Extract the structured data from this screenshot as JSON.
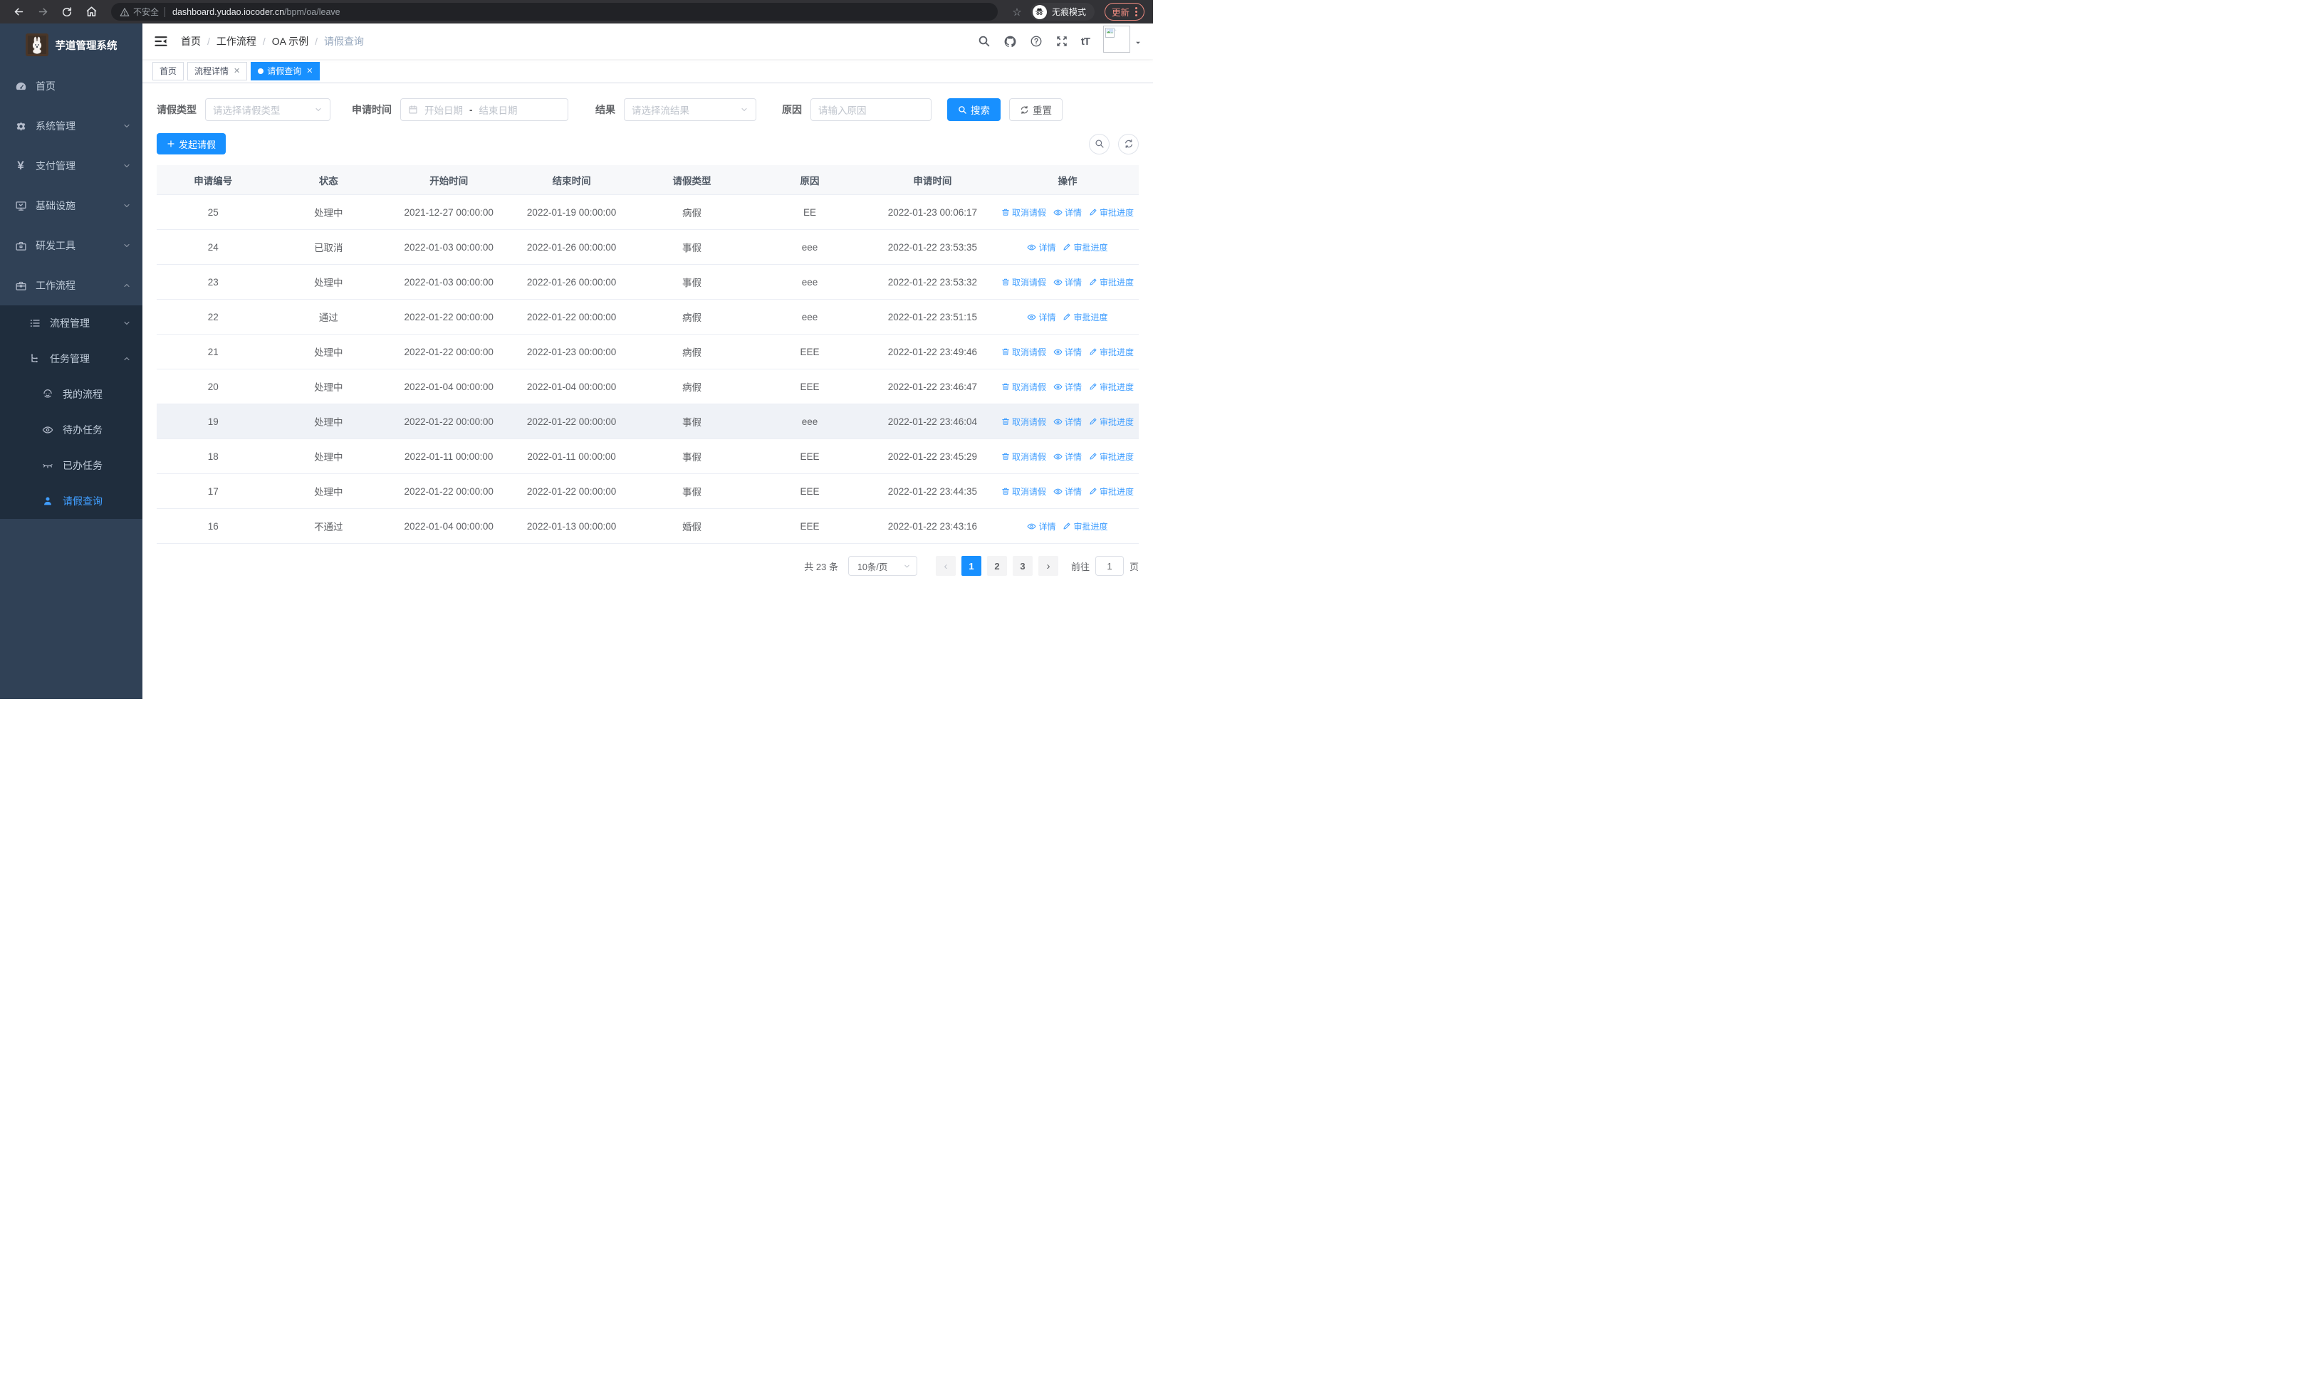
{
  "browser": {
    "security_label": "不安全",
    "url_host": "dashboard.yudao.iocoder.cn",
    "url_path": "/bpm/oa/leave",
    "incognito_label": "无痕模式",
    "update_label": "更新",
    "nav_icons": [
      "back-icon",
      "forward-icon",
      "reload-icon",
      "home-icon"
    ],
    "right_icons": [
      "bookmark-star-icon",
      "incognito-icon",
      "more-menu-icon"
    ]
  },
  "sidebar": {
    "title": "芋道管理系统",
    "items": [
      {
        "label": "首页",
        "icon": "dashboard-icon",
        "chevron": "none"
      },
      {
        "label": "系统管理",
        "icon": "gear-icon",
        "chevron": "down"
      },
      {
        "label": "支付管理",
        "icon": "yen-icon",
        "chevron": "down"
      },
      {
        "label": "基础设施",
        "icon": "monitor-icon",
        "chevron": "down"
      },
      {
        "label": "研发工具",
        "icon": "toolbox-icon",
        "chevron": "down"
      },
      {
        "label": "工作流程",
        "icon": "briefcase-icon",
        "chevron": "up"
      }
    ],
    "submenu": [
      {
        "label": "流程管理",
        "icon": "list-icon",
        "chevron": "down"
      },
      {
        "label": "任务管理",
        "icon": "flow-icon",
        "chevron": "up"
      }
    ],
    "task_items": [
      {
        "label": "我的流程",
        "icon": "robot-icon",
        "active": false
      },
      {
        "label": "待办任务",
        "icon": "eye-open-icon",
        "active": false
      },
      {
        "label": "已办任务",
        "icon": "eye-closed-icon",
        "active": false
      },
      {
        "label": "请假查询",
        "icon": "user-icon",
        "active": true
      }
    ]
  },
  "navbar": {
    "breadcrumb": [
      "首页",
      "工作流程",
      "OA 示例",
      "请假查询"
    ],
    "right_icons": [
      "search-icon",
      "github-icon",
      "help-icon",
      "fullscreen-icon",
      "font-size-icon",
      "avatar-image",
      "caret-down-icon"
    ]
  },
  "tabs": [
    {
      "label": "首页",
      "closable": false,
      "active": false
    },
    {
      "label": "流程详情",
      "closable": true,
      "active": false
    },
    {
      "label": "请假查询",
      "closable": true,
      "active": true
    }
  ],
  "filters": {
    "leave_type_label": "请假类型",
    "leave_type_placeholder": "请选择请假类型",
    "apply_time_label": "申请时间",
    "date_start_placeholder": "开始日期",
    "date_separator": "-",
    "date_end_placeholder": "结束日期",
    "result_label": "结果",
    "result_placeholder": "请选择流结果",
    "reason_label": "原因",
    "reason_placeholder": "请输入原因",
    "search_label": "搜索",
    "reset_label": "重置"
  },
  "toolbar": {
    "create_label": "发起请假",
    "icons": [
      "zoom-search-icon",
      "refresh-icon"
    ]
  },
  "table": {
    "columns": [
      "申请编号",
      "状态",
      "开始时间",
      "结束时间",
      "请假类型",
      "原因",
      "申请时间",
      "操作"
    ],
    "actions": {
      "cancel": "取消请假",
      "detail": "详情",
      "progress": "审批进度"
    },
    "rows": [
      {
        "id": "25",
        "status": "处理中",
        "start": "2021-12-27 00:00:00",
        "end": "2022-01-19 00:00:00",
        "type": "病假",
        "reason": "EE",
        "apply_time": "2022-01-23 00:06:17",
        "actions": [
          "cancel",
          "detail",
          "progress"
        ],
        "highlight": false
      },
      {
        "id": "24",
        "status": "已取消",
        "start": "2022-01-03 00:00:00",
        "end": "2022-01-26 00:00:00",
        "type": "事假",
        "reason": "eee",
        "apply_time": "2022-01-22 23:53:35",
        "actions": [
          "detail",
          "progress"
        ],
        "highlight": false
      },
      {
        "id": "23",
        "status": "处理中",
        "start": "2022-01-03 00:00:00",
        "end": "2022-01-26 00:00:00",
        "type": "事假",
        "reason": "eee",
        "apply_time": "2022-01-22 23:53:32",
        "actions": [
          "cancel",
          "detail",
          "progress"
        ],
        "highlight": false
      },
      {
        "id": "22",
        "status": "通过",
        "start": "2022-01-22 00:00:00",
        "end": "2022-01-22 00:00:00",
        "type": "病假",
        "reason": "eee",
        "apply_time": "2022-01-22 23:51:15",
        "actions": [
          "detail",
          "progress"
        ],
        "highlight": false
      },
      {
        "id": "21",
        "status": "处理中",
        "start": "2022-01-22 00:00:00",
        "end": "2022-01-23 00:00:00",
        "type": "病假",
        "reason": "EEE",
        "apply_time": "2022-01-22 23:49:46",
        "actions": [
          "cancel",
          "detail",
          "progress"
        ],
        "highlight": false
      },
      {
        "id": "20",
        "status": "处理中",
        "start": "2022-01-04 00:00:00",
        "end": "2022-01-04 00:00:00",
        "type": "病假",
        "reason": "EEE",
        "apply_time": "2022-01-22 23:46:47",
        "actions": [
          "cancel",
          "detail",
          "progress"
        ],
        "highlight": false
      },
      {
        "id": "19",
        "status": "处理中",
        "start": "2022-01-22 00:00:00",
        "end": "2022-01-22 00:00:00",
        "type": "事假",
        "reason": "eee",
        "apply_time": "2022-01-22 23:46:04",
        "actions": [
          "cancel",
          "detail",
          "progress"
        ],
        "highlight": true
      },
      {
        "id": "18",
        "status": "处理中",
        "start": "2022-01-11 00:00:00",
        "end": "2022-01-11 00:00:00",
        "type": "事假",
        "reason": "EEE",
        "apply_time": "2022-01-22 23:45:29",
        "actions": [
          "cancel",
          "detail",
          "progress"
        ],
        "highlight": false
      },
      {
        "id": "17",
        "status": "处理中",
        "start": "2022-01-22 00:00:00",
        "end": "2022-01-22 00:00:00",
        "type": "事假",
        "reason": "EEE",
        "apply_time": "2022-01-22 23:44:35",
        "actions": [
          "cancel",
          "detail",
          "progress"
        ],
        "highlight": false
      },
      {
        "id": "16",
        "status": "不通过",
        "start": "2022-01-04 00:00:00",
        "end": "2022-01-13 00:00:00",
        "type": "婚假",
        "reason": "EEE",
        "apply_time": "2022-01-22 23:43:16",
        "actions": [
          "detail",
          "progress"
        ],
        "highlight": false
      }
    ]
  },
  "pagination": {
    "total_label": "共 23 条",
    "page_size_value": "10条/页",
    "prev_icon": "‹",
    "next_icon": "›",
    "pages": [
      "1",
      "2",
      "3"
    ],
    "active_page": "1",
    "goto_label": "前往",
    "goto_value": "1",
    "goto_suffix": "页"
  }
}
